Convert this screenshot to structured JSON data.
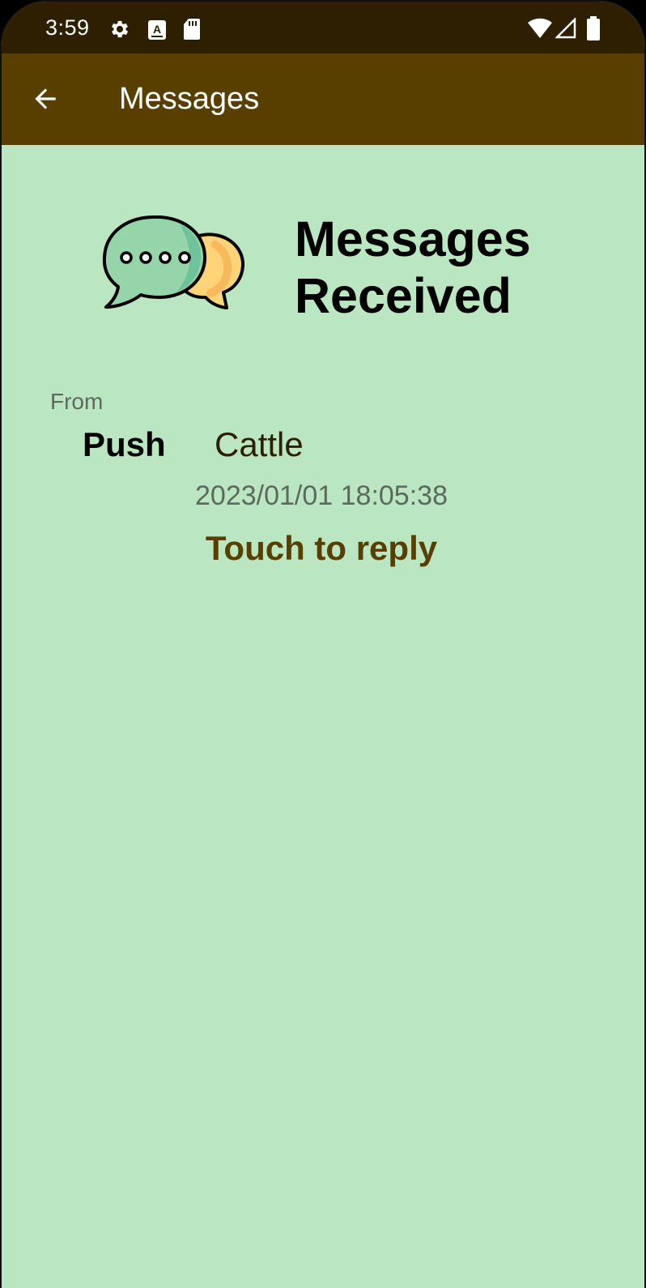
{
  "status_bar": {
    "time": "3:59",
    "icons": [
      "settings-gear-icon",
      "keyboard-a-icon",
      "sd-card-icon",
      "wifi-icon",
      "cell-signal-icon",
      "battery-icon"
    ]
  },
  "app_bar": {
    "title": "Messages",
    "back_icon": "arrow-left-icon"
  },
  "hero": {
    "icon": "chat-bubbles-icon",
    "title": "Messages Received"
  },
  "message": {
    "from_label": "From",
    "sender_first": "Push",
    "sender_last": "Cattle",
    "timestamp": "2023/01/01 18:05:38",
    "reply_label": "Touch to reply"
  },
  "colors": {
    "status_bar": "#2e1f00",
    "app_bar": "#583f00",
    "background": "#bae7c1",
    "accent": "#583f00"
  }
}
